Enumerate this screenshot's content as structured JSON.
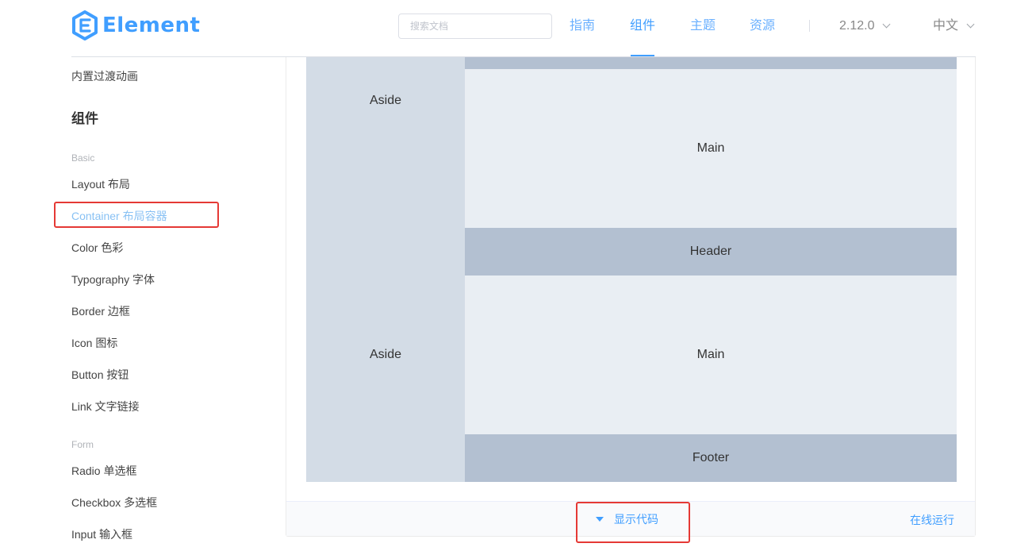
{
  "header": {
    "logo_text": "Element",
    "search_placeholder": "搜索文档",
    "nav": [
      "指南",
      "组件",
      "主题",
      "资源"
    ],
    "version": "2.12.0",
    "language": "中文"
  },
  "sidebar": {
    "top_item": "内置过渡动画",
    "group_title": "组件",
    "categories": [
      "Basic",
      "Form"
    ],
    "basic_items": [
      "Layout 布局",
      "Container 布局容器",
      "Color 色彩",
      "Typography 字体",
      "Border 边框",
      "Icon 图标",
      "Button 按钮",
      "Link 文字链接"
    ],
    "form_items": [
      "Radio 单选框",
      "Checkbox 多选框",
      "Input 输入框"
    ],
    "active_item": "Container 布局容器"
  },
  "demo": {
    "blocks": {
      "aside_1": "Aside",
      "main_1": "Main",
      "aside_2": "Aside",
      "header_2": "Header",
      "main_2": "Main",
      "footer_2": "Footer"
    },
    "show_code": "显示代码",
    "run_online": "在线运行"
  },
  "colors": {
    "accent": "#409eff",
    "aside": "#d3dce6",
    "main": "#e9eef3",
    "header_footer": "#b3c0d1",
    "highlight_box": "#e53935"
  }
}
